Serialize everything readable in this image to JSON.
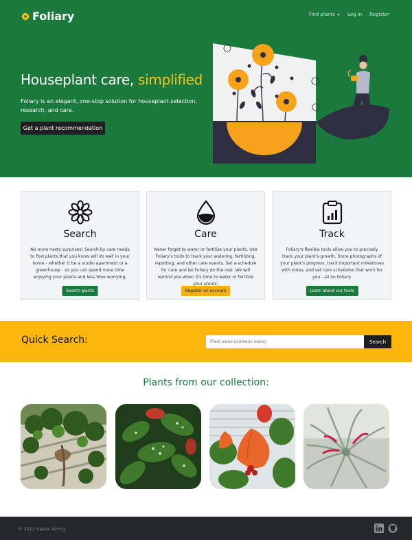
{
  "nav": {
    "brand": "Foliary",
    "links": [
      "Find plants",
      "Log In",
      "Register"
    ]
  },
  "hero": {
    "title_main": "Houseplant care, ",
    "title_accent": "simplified",
    "subtitle": "Foliary is an elegant, one-stop solution for houseplant selection, research, and care.",
    "button": "Get a plant recommendation"
  },
  "cards": [
    {
      "icon": "flower-icon",
      "title": "Search",
      "text": "No more nasty surprises! Search by care needs to find plants that you know will do well in your home - whether it be a studio apartment or a greenhouse - so you can spend more time enjoying your plants and less time worrying.",
      "button": "Search plants"
    },
    {
      "icon": "water-drop-icon",
      "title": "Care",
      "text": "Never forget to water or fertilize your plants. Use Foliary's tools to track your watering, fertilizing, repotting, and other care events. Set a schedule for care and let Foliary do the rest. We will remind you when it's time to water or fertilize your plants.",
      "button": "Register an account"
    },
    {
      "icon": "clipboard-chart-icon",
      "title": "Track",
      "text": "Foliary's flexible tools allow you to precisely track your plant's growth. Store photographs of your plant's progress, track important milestones with notes, and set care schedules that work for you - all on Foliary.",
      "button": "Learn about our tools"
    }
  ],
  "quick_search": {
    "label": "Quick Search:",
    "placeholder": "Plant name (common name)",
    "button": "Search"
  },
  "collection": {
    "title": "Plants from our collection:"
  },
  "footer": {
    "copyright": "© 2022 Sasha Vining",
    "icons": [
      "linkedin-icon",
      "github-icon"
    ]
  },
  "colors": {
    "brand_green": "#1a7a3e",
    "accent_yellow": "#f5c518",
    "quick_search_bg": "#fbb80b",
    "footer_bg": "#24272b"
  }
}
